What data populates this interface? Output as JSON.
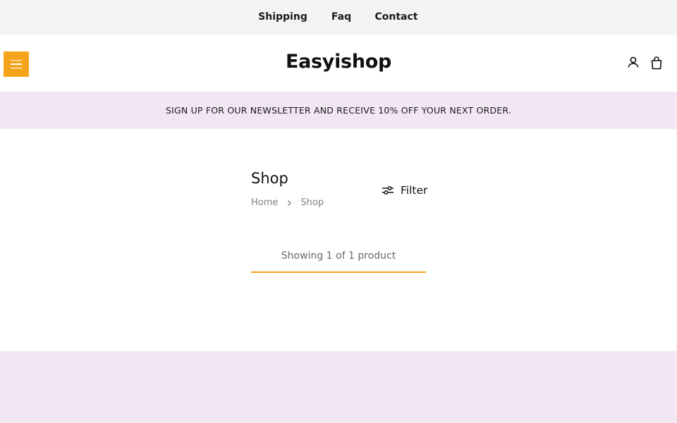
{
  "topnav": {
    "items": [
      {
        "label": "Shipping"
      },
      {
        "label": "Faq"
      },
      {
        "label": "Contact"
      }
    ]
  },
  "header": {
    "logo": "Easyishop",
    "menu_icon": "hamburger-menu-icon",
    "account_icon": "user-icon",
    "cart_icon": "shopping-bag-icon"
  },
  "announcement": {
    "text": "SIGN UP FOR OUR NEWSLETTER AND RECEIVE 10% OFF YOUR NEXT ORDER."
  },
  "main": {
    "title": "Shop",
    "breadcrumb": [
      {
        "label": "Home"
      },
      {
        "label": "Shop"
      }
    ],
    "filter_label": "Filter",
    "filter_icon": "sliders-icon",
    "showing": "Showing 1 of 1 product"
  },
  "colors": {
    "accent": "#f6a31b",
    "topbar_bg": "#f4f4f4",
    "announce_bg": "#f2e6f4",
    "footer_bg": "#f2e6f4"
  }
}
